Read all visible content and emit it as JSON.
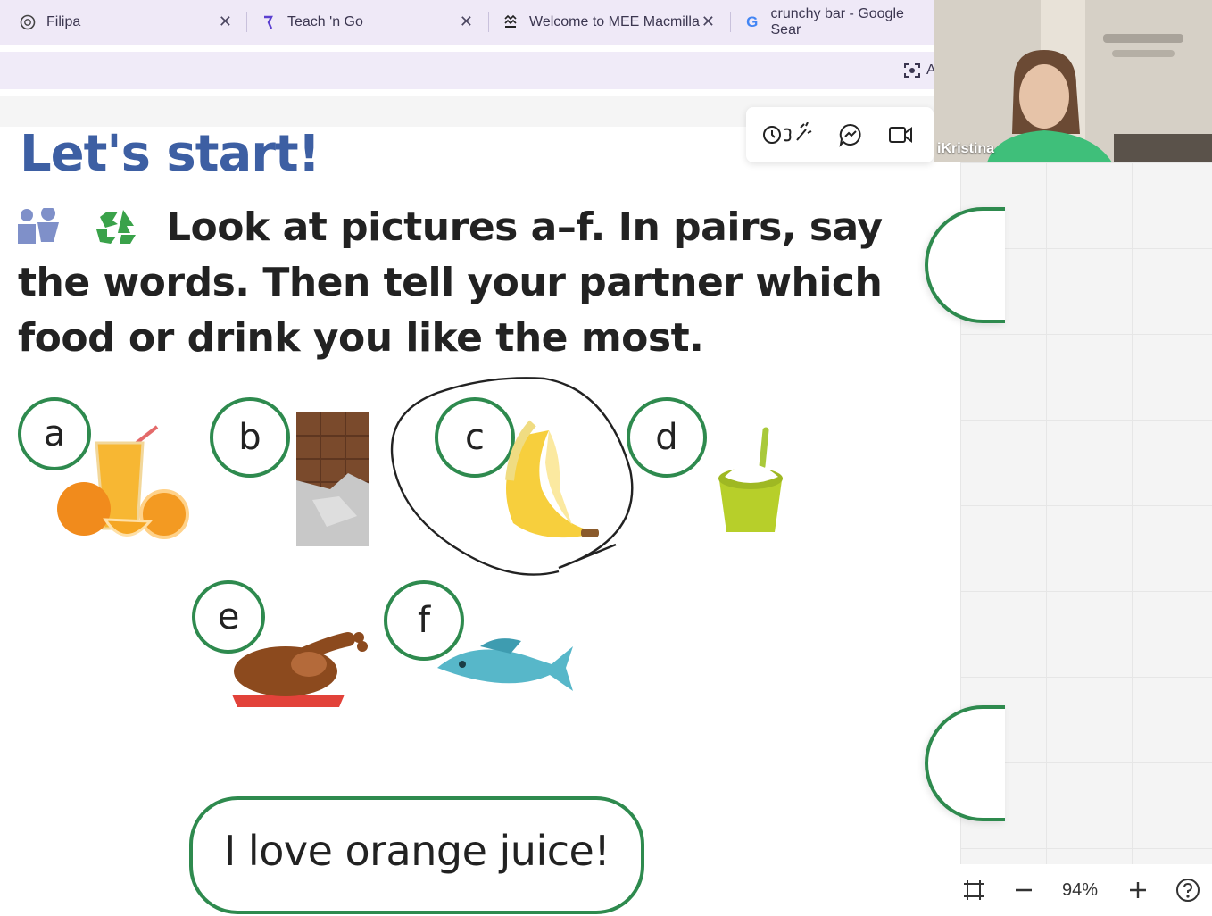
{
  "browser": {
    "tabs": [
      {
        "title": "Filipa",
        "favicon": "openai-icon"
      },
      {
        "title": "Teach 'n Go",
        "favicon": "teachngo-icon"
      },
      {
        "title": "Welcome to MEE Macmilla",
        "favicon": "macmillan-icon"
      },
      {
        "title": "crunchy bar - Google Sear",
        "favicon": "google-icon"
      }
    ],
    "toolbar_partial_label": "A"
  },
  "lesson": {
    "title": "Let's start!",
    "instruction": "Look at pictures a–f. In pairs, say the words. Then tell your partner which food or drink you like the most.",
    "items": [
      {
        "letter": "a",
        "picture": "orange-juice"
      },
      {
        "letter": "b",
        "picture": "chocolate-bar"
      },
      {
        "letter": "c",
        "picture": "banana"
      },
      {
        "letter": "d",
        "picture": "yogurt"
      },
      {
        "letter": "e",
        "picture": "roast-chicken"
      },
      {
        "letter": "f",
        "picture": "fish"
      }
    ],
    "speech_bubble": "I love orange juice!",
    "accent_color": "#2e8a4e",
    "title_color": "#3d5fa3"
  },
  "video": {
    "participant_name": "iKristina"
  },
  "zoom": {
    "level": "94%"
  }
}
